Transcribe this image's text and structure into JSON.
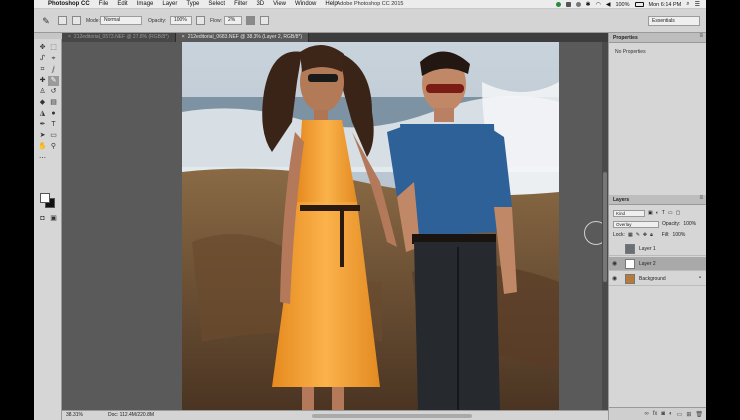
{
  "menubar": {
    "app_name": "Photoshop CC",
    "items": [
      "File",
      "Edit",
      "Image",
      "Layer",
      "Type",
      "Select",
      "Filter",
      "3D",
      "View",
      "Window",
      "Help"
    ],
    "window_title": "Adobe Photoshop CC 2015",
    "battery": "100%",
    "clock": "Mon 6:14 PM"
  },
  "options": {
    "mode_label": "Mode:",
    "mode_value": "Normal",
    "opacity_label": "Opacity:",
    "opacity_value": "100%",
    "flow_label": "Flow:",
    "flow_value": "2%",
    "workspace": "Essentials"
  },
  "tabs": [
    {
      "label": "212editorial_0573.NEF @ 27.8% (RGB/8*)"
    },
    {
      "label": "212editorial_0683.NEF @ 38.3% (Layer 2, RGB/8*)"
    }
  ],
  "panels": {
    "properties_title": "Properties",
    "properties_body": "No Properties",
    "layers_title": "Layers",
    "kind_value": "Kind",
    "blend_value": "Overlay",
    "opacity_label": "Opacity:",
    "opacity_value": "100%",
    "lock_label": "Lock:",
    "fill_label": "Fill:",
    "fill_value": "100%",
    "layers": [
      {
        "name": "Layer 1",
        "visible": false
      },
      {
        "name": "Layer 2",
        "visible": true
      },
      {
        "name": "Background",
        "visible": true
      }
    ]
  },
  "status": {
    "zoom": "38.31%",
    "doc": "Doc: 112.4M/220.8M"
  }
}
